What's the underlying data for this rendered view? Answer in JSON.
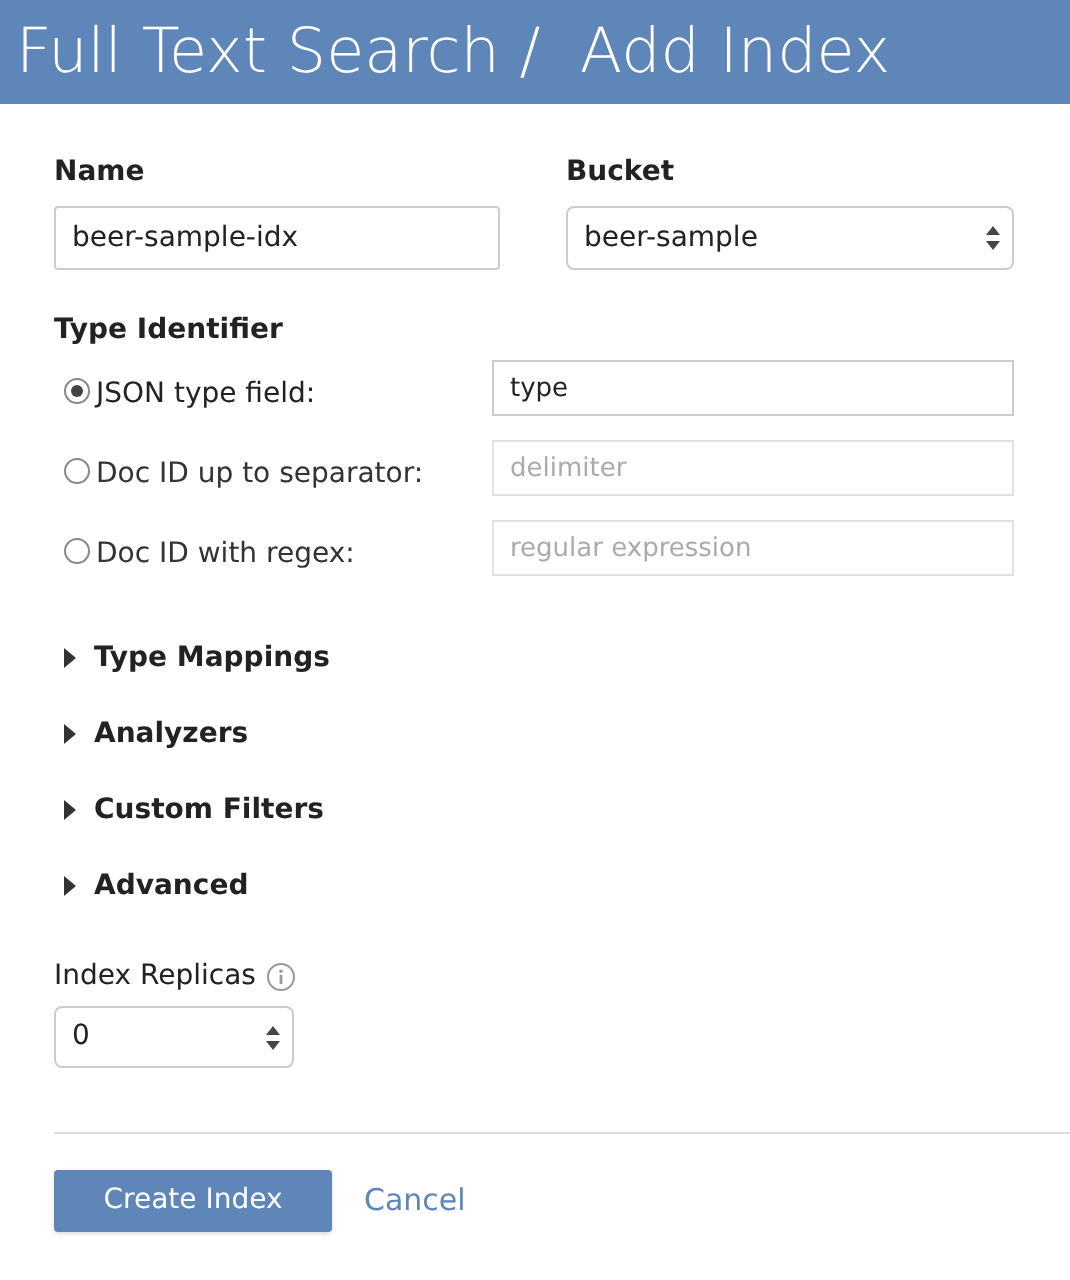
{
  "header": {
    "title": "Full Text Search /  Add Index"
  },
  "name": {
    "label": "Name",
    "value": "beer-sample-idx"
  },
  "bucket": {
    "label": "Bucket",
    "value": "beer-sample"
  },
  "type_identifier": {
    "label": "Type Identifier",
    "options": [
      {
        "label": "JSON type field:",
        "selected": true,
        "value": "type"
      },
      {
        "label": "Doc ID up to separator:",
        "selected": false,
        "placeholder": "delimiter"
      },
      {
        "label": "Doc ID with regex:",
        "selected": false,
        "placeholder": "regular expression"
      }
    ]
  },
  "sections": [
    {
      "label": "Type Mappings",
      "expanded": false
    },
    {
      "label": "Analyzers",
      "expanded": false
    },
    {
      "label": "Custom Filters",
      "expanded": false
    },
    {
      "label": "Advanced",
      "expanded": false
    }
  ],
  "replicas": {
    "label": "Index Replicas",
    "value": "0"
  },
  "buttons": {
    "create": "Create Index",
    "cancel": "Cancel"
  }
}
